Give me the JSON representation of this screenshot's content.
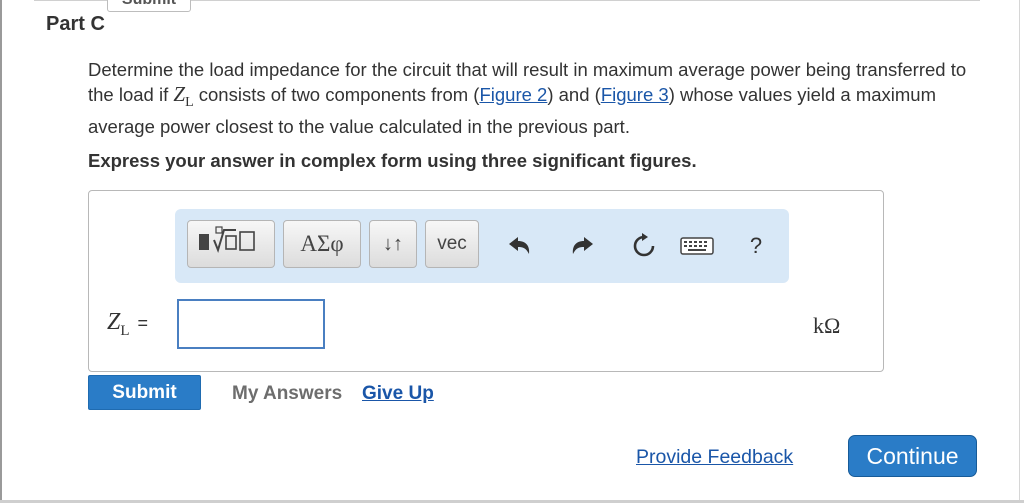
{
  "previous": {
    "submit_label": "Submit"
  },
  "part": {
    "title": "Part C"
  },
  "question": {
    "text_before": "Determine the load impedance for the circuit that will result in maximum average power being transferred to the load if ",
    "zl_symbol": "Z",
    "zl_subscript": "L",
    "text_middle": " consists of two components from (",
    "figure2_link": "Figure 2",
    "text_and": ") and (",
    "figure3_link": "Figure 3",
    "text_after": ") whose values yield a maximum average power closest to the value calculated in the previous part."
  },
  "instruction": "Express your answer in complex form using three significant figures.",
  "toolbar": {
    "greek_label": "ΑΣφ",
    "arrows_label": "↓↑",
    "vec_label": "vec",
    "help_label": "?",
    "icons": [
      "templates-icon",
      "undo-icon",
      "redo-icon",
      "reset-icon",
      "keyboard-icon"
    ]
  },
  "answer": {
    "variable": "Z",
    "subscript": "L",
    "equals": "=",
    "value": "",
    "unit": "kΩ"
  },
  "actions": {
    "submit_label": "Submit",
    "my_answers_label": "My Answers",
    "give_up_label": "Give Up"
  },
  "footer": {
    "feedback_label": "Provide Feedback",
    "continue_label": "Continue"
  },
  "colors": {
    "link": "#1a56a8",
    "button": "#2a7cc7",
    "toolbar_bg": "#d8e8f7"
  }
}
